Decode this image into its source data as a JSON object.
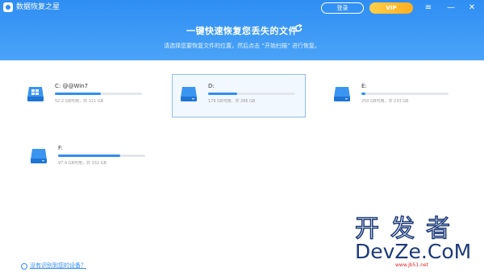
{
  "app": {
    "name": "数据恢复之星",
    "login_label": "登录",
    "vip_label": "VIP"
  },
  "window_controls": {
    "menu": "≡",
    "minimize": "—",
    "close": "✕"
  },
  "header": {
    "headline": "一键快速恢复您丢失的文件",
    "subline": "请选择您要恢复文件的位置，然后点击 “开始扫描” 进行恢复。"
  },
  "drives": [
    {
      "name": "C: @@Win7",
      "usage": "52.2 GB可用，共 111 GB",
      "used_fraction": 0.53,
      "selected": false
    },
    {
      "name": "D:",
      "usage": "179 GB可用，共 266 GB",
      "used_fraction": 0.33,
      "selected": true
    },
    {
      "name": "E:",
      "usage": "250 GB可用，共 233 GB",
      "used_fraction": 0.05,
      "selected": false
    },
    {
      "name": "F:",
      "usage": "97.4 GB可用，共 332 GB",
      "used_fraction": 0.71,
      "selected": false
    }
  ],
  "help_link": "没有识别到您的设备？",
  "watermark": {
    "cn": "开发者",
    "en": "DevZe.CoM",
    "url": "www.jb51.net"
  },
  "colors": {
    "accent": "#2f8ef3",
    "vip": "#ffae1f"
  }
}
